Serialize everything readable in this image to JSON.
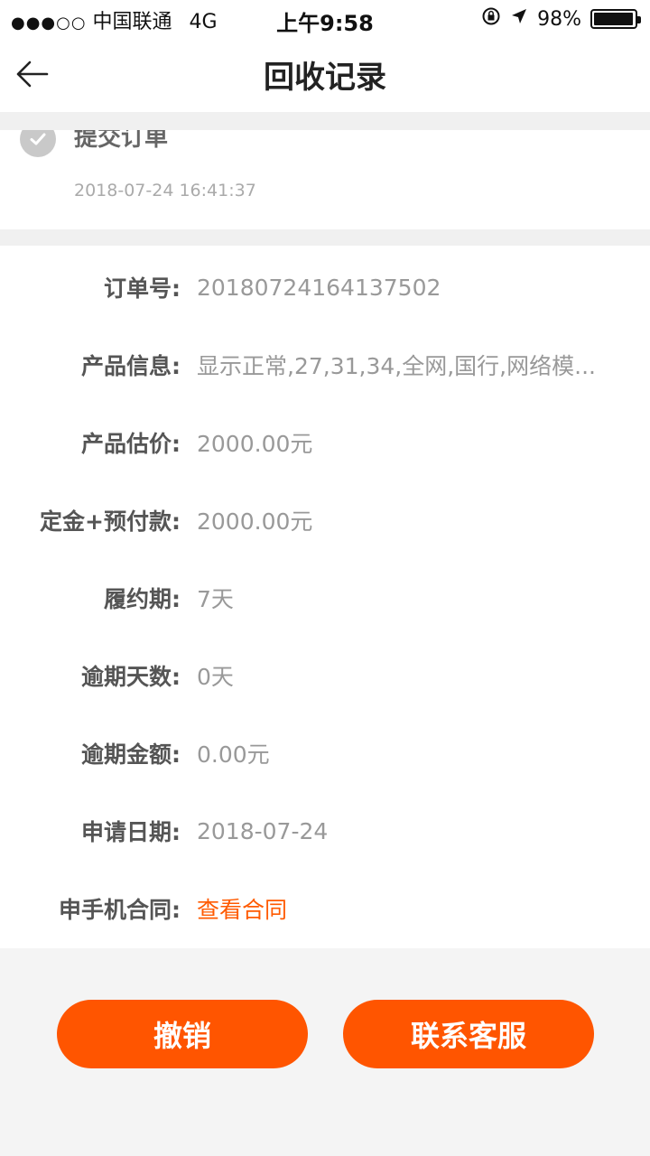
{
  "status_bar": {
    "signal_dots": "●●●○○",
    "carrier": "中国联通",
    "network": "4G",
    "time": "上午9:58",
    "battery_text": "98%",
    "battery_level_percent": 98,
    "icons": [
      "orientation-lock-icon",
      "location-arrow-icon",
      "battery-icon"
    ]
  },
  "nav": {
    "title": "回收记录",
    "back_icon": "back-arrow-icon"
  },
  "timeline": {
    "label": "提交订单",
    "time": "2018-07-24 16:41:37",
    "icon": "check-circle-icon"
  },
  "details": {
    "rows": [
      {
        "label": "订单号:",
        "value": "20180724164137502"
      },
      {
        "label": "产品信息:",
        "value": "显示正常,27,31,34,全网,国行,网络模..."
      },
      {
        "label": "产品估价:",
        "value": "2000.00元"
      },
      {
        "label": "定金+预付款:",
        "value": "2000.00元"
      },
      {
        "label": "履约期:",
        "value": "7天"
      },
      {
        "label": "逾期天数:",
        "value": "0天"
      },
      {
        "label": "逾期金额:",
        "value": "0.00元"
      },
      {
        "label": "申请日期:",
        "value": "2018-07-24"
      },
      {
        "label": "申手机合同:",
        "value": "查看合同"
      }
    ]
  },
  "actions": {
    "cancel_label": "撤销",
    "contact_label": "联系客服"
  },
  "colors": {
    "accent": "#ff5500",
    "link": "#ff5a00",
    "label": "#555555",
    "value": "#999999"
  }
}
